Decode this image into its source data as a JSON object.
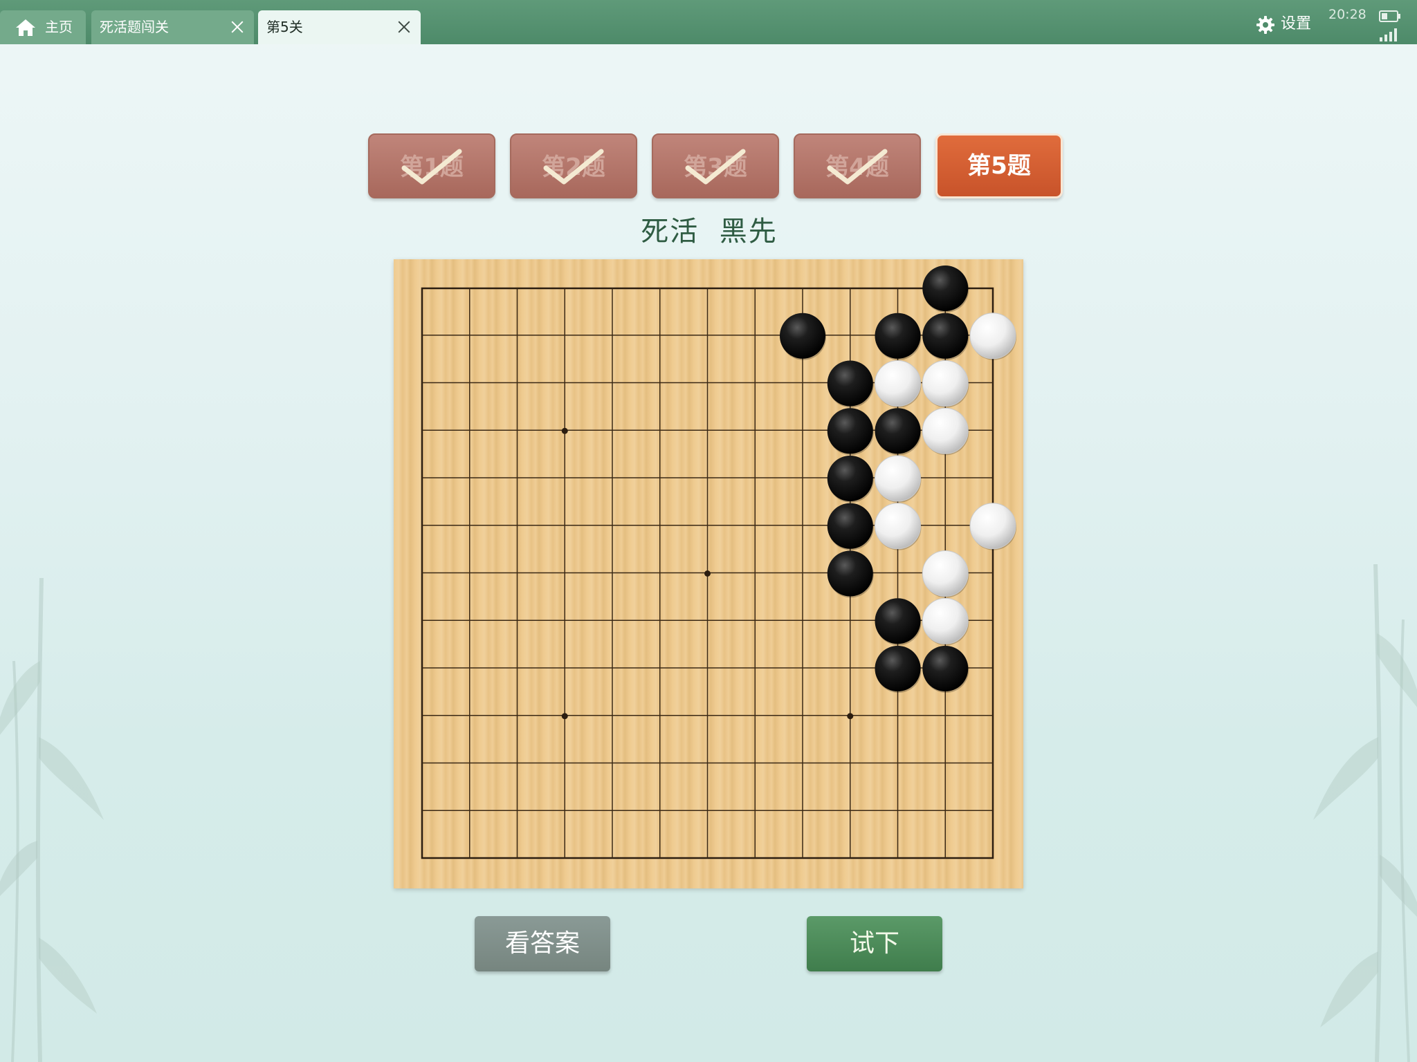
{
  "tabs": {
    "home": "主页",
    "deadlive": "死活题闯关",
    "level": "第5关"
  },
  "status": {
    "settings": "设置",
    "time": "20:28"
  },
  "problems": [
    {
      "label": "第1题",
      "solved": true
    },
    {
      "label": "第2题",
      "solved": true
    },
    {
      "label": "第3题",
      "solved": true
    },
    {
      "label": "第4题",
      "solved": true
    },
    {
      "label": "第5题",
      "solved": false,
      "active": true
    }
  ],
  "problem_info": {
    "title": "死活  黑先"
  },
  "board": {
    "size": 13,
    "star_points": [
      [
        3,
        3
      ],
      [
        6,
        6
      ],
      [
        3,
        9
      ],
      [
        9,
        9
      ]
    ],
    "black_stones": [
      [
        11,
        0
      ],
      [
        8,
        1
      ],
      [
        10,
        1
      ],
      [
        11,
        1
      ],
      [
        9,
        2
      ],
      [
        9,
        3
      ],
      [
        10,
        3
      ],
      [
        9,
        4
      ],
      [
        9,
        5
      ],
      [
        9,
        6
      ],
      [
        10,
        7
      ],
      [
        10,
        8
      ],
      [
        11,
        8
      ]
    ],
    "white_stones": [
      [
        12,
        1
      ],
      [
        10,
        2
      ],
      [
        11,
        2
      ],
      [
        11,
        3
      ],
      [
        10,
        4
      ],
      [
        10,
        5
      ],
      [
        12,
        5
      ],
      [
        11,
        6
      ],
      [
        11,
        7
      ]
    ]
  },
  "buttons": {
    "answer": "看答案",
    "try": "试下"
  },
  "colors": {
    "topbar": "#4d8a69",
    "active_problem": "#d05c30",
    "solved_problem": "#b07569",
    "answer_button": "#7f8e89",
    "try_button": "#4a8a57"
  },
  "icons": [
    "home-icon",
    "close-icon",
    "gear-icon",
    "battery-icon",
    "signal-icon",
    "checkmark-icon"
  ]
}
